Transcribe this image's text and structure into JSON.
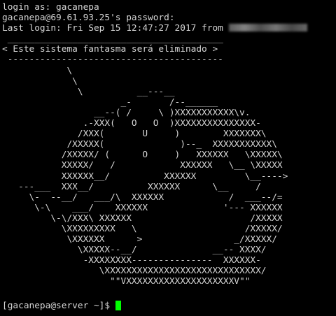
{
  "session": {
    "login_prompt": "login as: gacanepa",
    "password_prompt": "gacanepa@69.61.93.25's password:",
    "last_login_prefix": "Last login: Fri Sep 15 12:47:27 2017 from "
  },
  "motd": [
    " ________________________________________",
    "< Este sistema fantasma será eliminado >",
    " ----------------------------------------",
    "            \\",
    "             \\",
    "              \\          __---__",
    "                      _-       /--______",
    "                 __--( /     \\ )XXXXXXXXXXX\\v.",
    "               .-XXX(   O   O  )XXXXXXXXXXXXXXX-",
    "              /XXX(       U     )        XXXXXXX\\",
    "            /XXXXX(              )--_  XXXXXXXXXXX\\",
    "           /XXXXX/ (      O     )   XXXXXX   \\XXXXX\\",
    "           XXXXX/   /            XXXXXX   \\__ \\XXXXX",
    "           XXXXXX__/          XXXXXX         \\__---->",
    "   ---___  XXX__/          XXXXXX      \\__     /",
    "     \\-  --__/   ___/\\  XXXXXX            /  ___--/=",
    "      \\-\\    ___/    XXXXXX              '--- XXXXXX",
    "         \\-\\/XXX\\ XXXXXX                      /XXXXX",
    "           \\XXXXXXXXX   \\                    /XXXXX/",
    "            \\XXXXXX      >                 _/XXXXX/",
    "              \\XXXXX--__/              __-- XXXX/",
    "               -XXXXXXXX---------------  XXXXXX-",
    "                  \\XXXXXXXXXXXXXXXXXXXXXXXXXXXXX/",
    "                    \"\"VXXXXXXXXXXXXXXXXXXXXV\"\""
  ],
  "prompt": "[gacanepa@server ~]$ ",
  "colors": {
    "background": "#000000",
    "foreground": "#d6d6d6",
    "cursor": "#00ff00"
  }
}
